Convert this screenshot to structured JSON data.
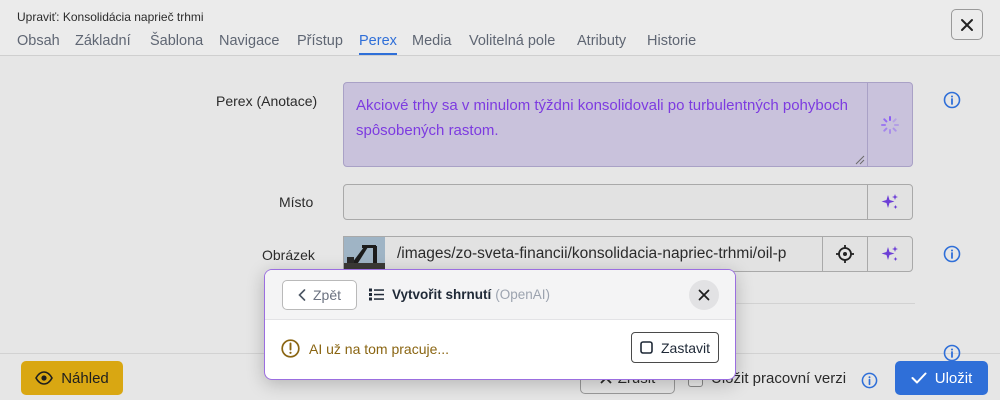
{
  "window": {
    "title": "Upraviť: Konsolidácia naprieč trhmi"
  },
  "tabs": [
    {
      "label": "Obsah"
    },
    {
      "label": "Základní"
    },
    {
      "label": "Šablona"
    },
    {
      "label": "Navigace"
    },
    {
      "label": "Přístup"
    },
    {
      "label": "Perex",
      "active": true
    },
    {
      "label": "Media"
    },
    {
      "label": "Volitelná pole"
    },
    {
      "label": "Atributy"
    },
    {
      "label": "Historie"
    }
  ],
  "form": {
    "perex": {
      "label": "Perex (Anotace)",
      "value": "Akciové trhy sa v minulom týždni konsolidovali po turbulentných pohyboch spôsobených rastom."
    },
    "misto": {
      "label": "Místo",
      "value": ""
    },
    "obrazek": {
      "label": "Obrázek",
      "path": "/images/zo-sveta-financii/konsolidacia-napriec-trhmi/oil-p"
    }
  },
  "footer": {
    "preview_label": "Náhled",
    "cancel_label": "Zrušit",
    "work_version_label": "Uložit pracovní verzi",
    "save_label": "Uložit"
  },
  "modal": {
    "back_label": "Zpět",
    "title": "Vytvořit shrnutí",
    "provider": "(OpenAI)",
    "warning": "AI už na tom pracuje...",
    "stop_label": "Zastavit"
  },
  "colors": {
    "accent": "#2f6fd8",
    "ai_purple": "#7d3be0",
    "preview_yellow": "#d9a712",
    "warning": "#8a6512"
  }
}
